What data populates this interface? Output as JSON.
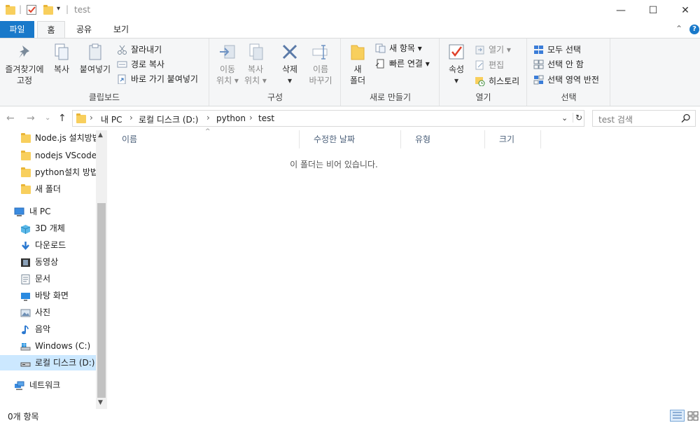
{
  "window": {
    "title": "test",
    "minimize": "—",
    "maximize": "☐",
    "close": "✕"
  },
  "tabs": [
    {
      "label": "파일"
    },
    {
      "label": "홈"
    },
    {
      "label": "공유"
    },
    {
      "label": "보기"
    }
  ],
  "ribbon": {
    "clipboard": {
      "label": "클립보드",
      "pin": "즐겨찾기에\n고정",
      "copy": "복사",
      "paste": "붙여넣기",
      "cut": "잘라내기",
      "copy_path": "경로 복사",
      "paste_shortcut": "바로 가기 붙여넣기"
    },
    "organize": {
      "label": "구성",
      "move_to": "이동\n위치 ▾",
      "copy_to": "복사\n위치 ▾",
      "delete": "삭제\n▾",
      "rename": "이름\n바꾸기"
    },
    "new": {
      "label": "새로 만들기",
      "new_folder": "새\n폴더",
      "new_item": "새 항목 ▾",
      "easy_access": "빠른 연결 ▾"
    },
    "open": {
      "label": "열기",
      "properties": "속성\n▾",
      "open": "열기 ▾",
      "edit": "편집",
      "history": "히스토리"
    },
    "select": {
      "label": "선택",
      "select_all": "모두 선택",
      "select_none": "선택 안 함",
      "invert": "선택 영역 반전"
    }
  },
  "address": {
    "crumbs": [
      "내 PC",
      "로컬 디스크 (D:)",
      "python",
      "test"
    ],
    "search_placeholder": "test 검색"
  },
  "nav": {
    "folders": [
      {
        "label": "Node.js 설치방법"
      },
      {
        "label": "nodejs VScode 연"
      },
      {
        "label": "python설치 방법"
      },
      {
        "label": "새 폴더"
      }
    ],
    "this_pc": "내 PC",
    "pc_items": [
      {
        "label": "3D 개체",
        "icon": "cube-3d-icon"
      },
      {
        "label": "다운로드",
        "icon": "download-arrow-icon"
      },
      {
        "label": "동영상",
        "icon": "film-icon"
      },
      {
        "label": "문서",
        "icon": "document-icon"
      },
      {
        "label": "바탕 화면",
        "icon": "desktop-icon"
      },
      {
        "label": "사진",
        "icon": "picture-icon"
      },
      {
        "label": "음악",
        "icon": "music-note-icon"
      },
      {
        "label": "Windows (C:)",
        "icon": "windows-drive-icon"
      },
      {
        "label": "로컬 디스크 (D:)",
        "icon": "drive-icon"
      }
    ],
    "network": "네트워크"
  },
  "columns": [
    {
      "label": "이름"
    },
    {
      "label": "수정한 날짜"
    },
    {
      "label": "유형"
    },
    {
      "label": "크기"
    }
  ],
  "empty_message": "이 폴더는 비어 있습니다.",
  "status": {
    "count": "0개 항목"
  },
  "colors": {
    "file_tab": "#1979ca",
    "folder": "#f8cf5d",
    "selected_bg": "#cce8ff",
    "header_text": "#4c607a"
  }
}
